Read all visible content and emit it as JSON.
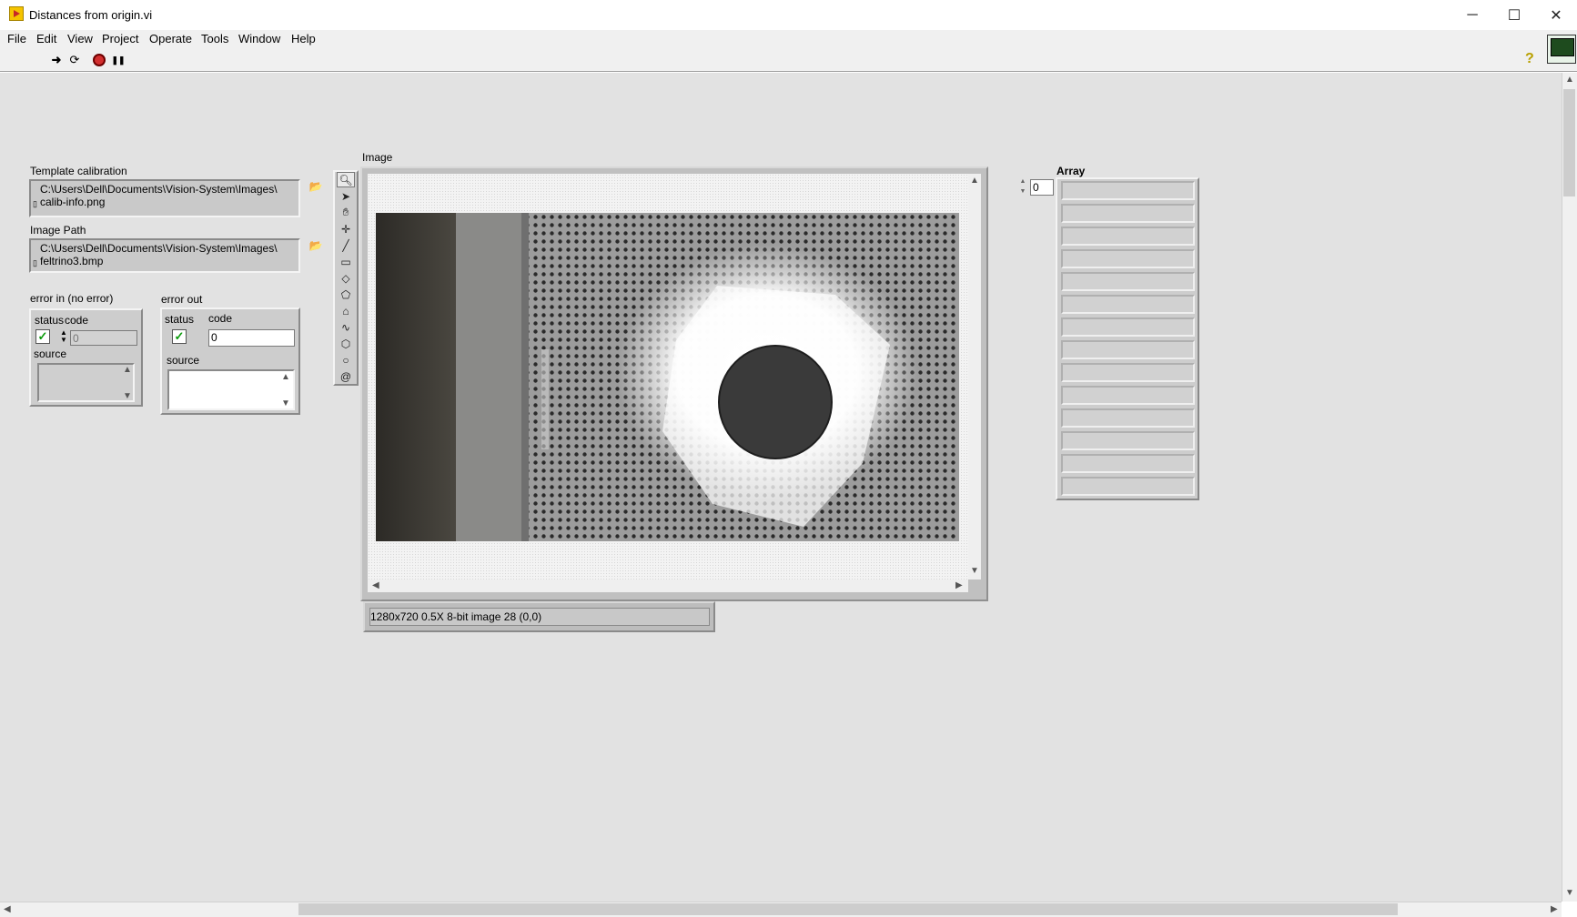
{
  "window": {
    "title": "Distances from origin.vi",
    "minimize": "─",
    "maximize": "☐",
    "close": "✕"
  },
  "menu": [
    "File",
    "Edit",
    "View",
    "Project",
    "Operate",
    "Tools",
    "Window",
    "Help"
  ],
  "toolbar": {
    "run": "➜",
    "run_continuously": "⟳",
    "pause": "❚❚",
    "help": "?"
  },
  "controls": {
    "template_calibration": {
      "label": "Template calibration",
      "path": "C:\\Users\\Dell\\Documents\\Vision-System\\Images\\ calib-info.png"
    },
    "image_path": {
      "label": "Image Path",
      "path": "C:\\Users\\Dell\\Documents\\Vision-System\\Images\\ feltrino3.bmp"
    },
    "error_in": {
      "label": "error in (no error)",
      "status_label": "status",
      "code_label": "code",
      "code_value": "0",
      "source_label": "source",
      "status": true
    },
    "error_out": {
      "label": "error out",
      "status_label": "status",
      "code_label": "code",
      "code_value": "0",
      "source_label": "source",
      "status": true
    }
  },
  "image_display": {
    "label": "Image",
    "status_text": "1280x720 0.5X 8-bit image 28    (0,0)"
  },
  "array": {
    "label": "Array",
    "index": "0",
    "cell_count": 14
  },
  "icons": {
    "browse": "folder-icon",
    "tools": [
      "zoom-icon",
      "pointer-icon",
      "pan-icon",
      "point-icon",
      "line-icon",
      "rectangle-icon",
      "rotated-rect-icon",
      "polygon-icon",
      "polyline-icon",
      "freehand-icon",
      "annulus-icon",
      "oval-icon",
      "spiral-icon"
    ]
  },
  "colors": {
    "panel": "#e2e2e2",
    "status_ok": "#0a9a0a",
    "abort": "#d32f2f"
  }
}
